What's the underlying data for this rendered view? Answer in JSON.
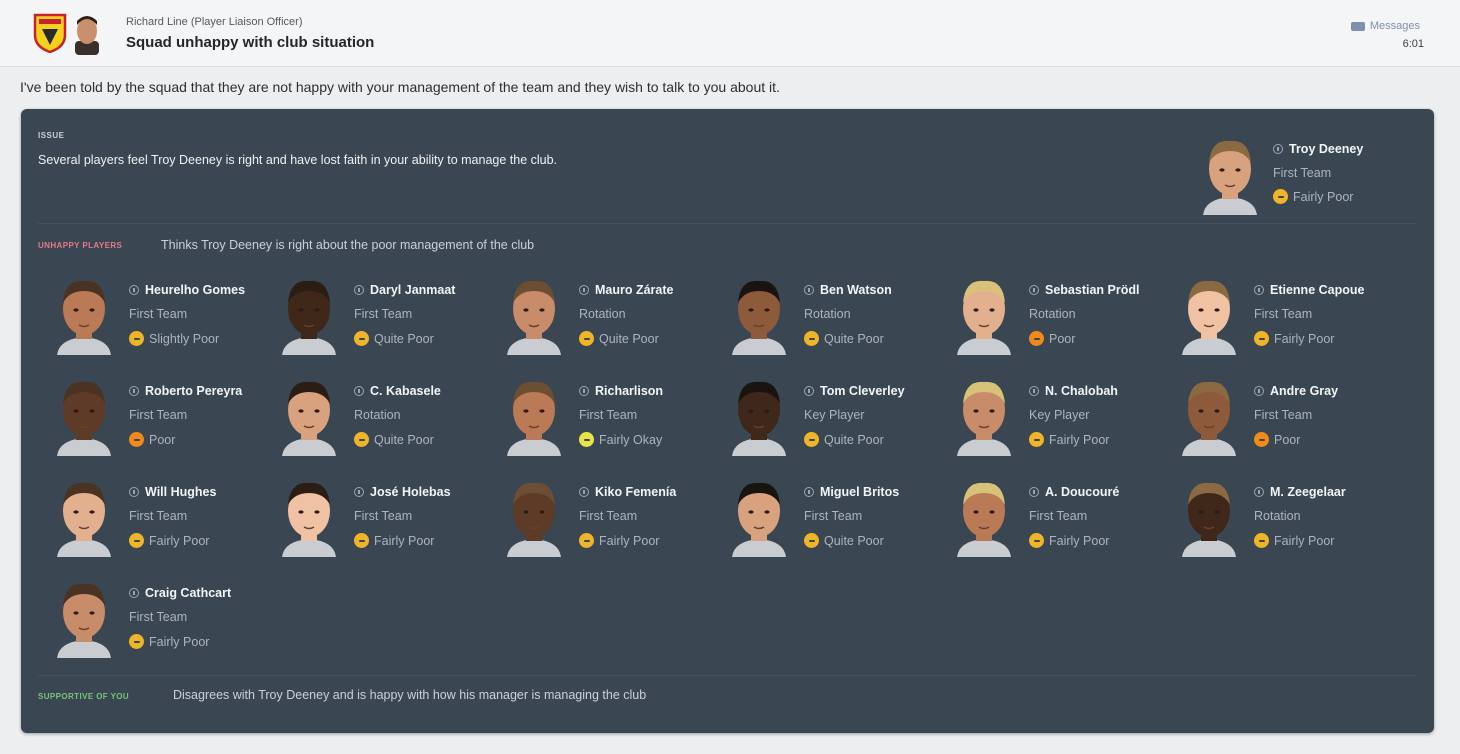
{
  "header": {
    "sender": "Richard Line  (Player Liaison Officer)",
    "subject": "Squad unhappy with club situation",
    "messages_link": "Messages",
    "time": "6:01",
    "badge_icon": "club-badge-icon",
    "colors": {
      "badge_yellow": "#f4d11a",
      "badge_red": "#c8232c"
    }
  },
  "message": "I've been told by the squad that they are not happy with your management of the team and they wish to talk to you about it.",
  "issue": {
    "label": "ISSUE",
    "text": "Several players feel Troy Deeney is right and have lost faith in your ability to manage the club.",
    "player": {
      "name": "Troy Deeney",
      "role": "First Team",
      "status": "Fairly Poor"
    }
  },
  "unhappy": {
    "label": "UNHAPPY PLAYERS",
    "text": "Thinks Troy Deeney is right about the poor management of the club",
    "players": [
      {
        "name": "Heurelho Gomes",
        "role": "First Team",
        "status": "Slightly Poor",
        "mood": "poor"
      },
      {
        "name": "Daryl Janmaat",
        "role": "First Team",
        "status": "Quite Poor",
        "mood": "poor"
      },
      {
        "name": "Mauro Zárate",
        "role": "Rotation",
        "status": "Quite Poor",
        "mood": "poor"
      },
      {
        "name": "Ben Watson",
        "role": "Rotation",
        "status": "Quite Poor",
        "mood": "poor"
      },
      {
        "name": "Sebastian Prödl",
        "role": "Rotation",
        "status": "Poor",
        "mood": "bad"
      },
      {
        "name": "Etienne Capoue",
        "role": "First Team",
        "status": "Fairly Poor",
        "mood": "poor"
      },
      {
        "name": "Roberto Pereyra",
        "role": "First Team",
        "status": "Poor",
        "mood": "bad"
      },
      {
        "name": "C. Kabasele",
        "role": "Rotation",
        "status": "Quite Poor",
        "mood": "poor"
      },
      {
        "name": "Richarlison",
        "role": "First Team",
        "status": "Fairly Okay",
        "mood": "okay"
      },
      {
        "name": "Tom Cleverley",
        "role": "Key Player",
        "status": "Quite Poor",
        "mood": "poor"
      },
      {
        "name": "N. Chalobah",
        "role": "Key Player",
        "status": "Fairly Poor",
        "mood": "poor"
      },
      {
        "name": "Andre Gray",
        "role": "First Team",
        "status": "Poor",
        "mood": "bad"
      },
      {
        "name": "Will Hughes",
        "role": "First Team",
        "status": "Fairly Poor",
        "mood": "poor"
      },
      {
        "name": "José Holebas",
        "role": "First Team",
        "status": "Fairly Poor",
        "mood": "poor"
      },
      {
        "name": "Kiko Femenía",
        "role": "First Team",
        "status": "Fairly Poor",
        "mood": "poor"
      },
      {
        "name": "Miguel Britos",
        "role": "First Team",
        "status": "Quite Poor",
        "mood": "poor"
      },
      {
        "name": "A. Doucouré",
        "role": "First Team",
        "status": "Fairly Poor",
        "mood": "poor"
      },
      {
        "name": "M. Zeegelaar",
        "role": "Rotation",
        "status": "Fairly Poor",
        "mood": "poor"
      },
      {
        "name": "Craig Cathcart",
        "role": "First Team",
        "status": "Fairly Poor",
        "mood": "poor"
      }
    ]
  },
  "supportive": {
    "label": "SUPPORTIVE OF YOU",
    "text": "Disagrees with Troy Deeney and is happy with how his manager is managing the club"
  },
  "mood_colors": {
    "poor": "#f0b429",
    "bad": "#f08a1a",
    "okay": "#e8e34a"
  },
  "skin_tones": [
    "#e3b08f",
    "#d9a27f",
    "#c98c6a",
    "#f0c2a3",
    "#b97a55",
    "#8d5a3b",
    "#5e3b27",
    "#3f2719"
  ],
  "hair_colors": [
    "#2b1d14",
    "#4a3322",
    "#8b6a43",
    "#d8c27a",
    "#1a1410",
    "#6b4e34"
  ]
}
